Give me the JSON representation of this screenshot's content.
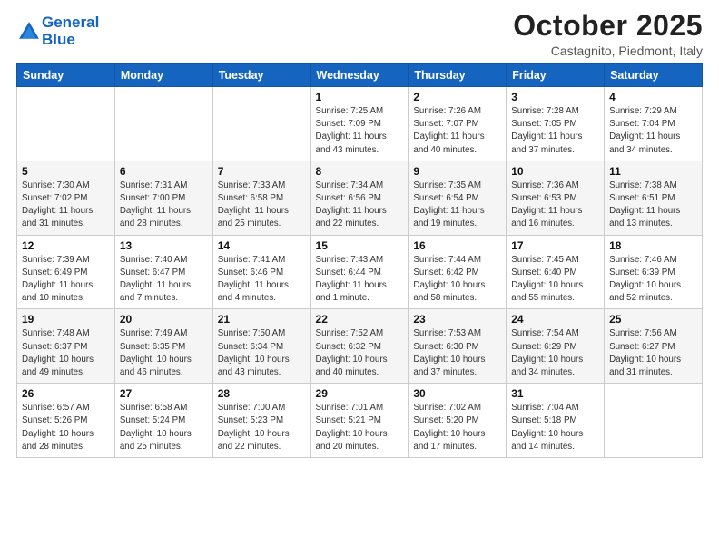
{
  "header": {
    "logo_line1": "General",
    "logo_line2": "Blue",
    "main_title": "October 2025",
    "subtitle": "Castagnito, Piedmont, Italy"
  },
  "days_of_week": [
    "Sunday",
    "Monday",
    "Tuesday",
    "Wednesday",
    "Thursday",
    "Friday",
    "Saturday"
  ],
  "weeks": [
    [
      {
        "day": "",
        "detail": ""
      },
      {
        "day": "",
        "detail": ""
      },
      {
        "day": "",
        "detail": ""
      },
      {
        "day": "1",
        "detail": "Sunrise: 7:25 AM\nSunset: 7:09 PM\nDaylight: 11 hours\nand 43 minutes."
      },
      {
        "day": "2",
        "detail": "Sunrise: 7:26 AM\nSunset: 7:07 PM\nDaylight: 11 hours\nand 40 minutes."
      },
      {
        "day": "3",
        "detail": "Sunrise: 7:28 AM\nSunset: 7:05 PM\nDaylight: 11 hours\nand 37 minutes."
      },
      {
        "day": "4",
        "detail": "Sunrise: 7:29 AM\nSunset: 7:04 PM\nDaylight: 11 hours\nand 34 minutes."
      }
    ],
    [
      {
        "day": "5",
        "detail": "Sunrise: 7:30 AM\nSunset: 7:02 PM\nDaylight: 11 hours\nand 31 minutes."
      },
      {
        "day": "6",
        "detail": "Sunrise: 7:31 AM\nSunset: 7:00 PM\nDaylight: 11 hours\nand 28 minutes."
      },
      {
        "day": "7",
        "detail": "Sunrise: 7:33 AM\nSunset: 6:58 PM\nDaylight: 11 hours\nand 25 minutes."
      },
      {
        "day": "8",
        "detail": "Sunrise: 7:34 AM\nSunset: 6:56 PM\nDaylight: 11 hours\nand 22 minutes."
      },
      {
        "day": "9",
        "detail": "Sunrise: 7:35 AM\nSunset: 6:54 PM\nDaylight: 11 hours\nand 19 minutes."
      },
      {
        "day": "10",
        "detail": "Sunrise: 7:36 AM\nSunset: 6:53 PM\nDaylight: 11 hours\nand 16 minutes."
      },
      {
        "day": "11",
        "detail": "Sunrise: 7:38 AM\nSunset: 6:51 PM\nDaylight: 11 hours\nand 13 minutes."
      }
    ],
    [
      {
        "day": "12",
        "detail": "Sunrise: 7:39 AM\nSunset: 6:49 PM\nDaylight: 11 hours\nand 10 minutes."
      },
      {
        "day": "13",
        "detail": "Sunrise: 7:40 AM\nSunset: 6:47 PM\nDaylight: 11 hours\nand 7 minutes."
      },
      {
        "day": "14",
        "detail": "Sunrise: 7:41 AM\nSunset: 6:46 PM\nDaylight: 11 hours\nand 4 minutes."
      },
      {
        "day": "15",
        "detail": "Sunrise: 7:43 AM\nSunset: 6:44 PM\nDaylight: 11 hours\nand 1 minute."
      },
      {
        "day": "16",
        "detail": "Sunrise: 7:44 AM\nSunset: 6:42 PM\nDaylight: 10 hours\nand 58 minutes."
      },
      {
        "day": "17",
        "detail": "Sunrise: 7:45 AM\nSunset: 6:40 PM\nDaylight: 10 hours\nand 55 minutes."
      },
      {
        "day": "18",
        "detail": "Sunrise: 7:46 AM\nSunset: 6:39 PM\nDaylight: 10 hours\nand 52 minutes."
      }
    ],
    [
      {
        "day": "19",
        "detail": "Sunrise: 7:48 AM\nSunset: 6:37 PM\nDaylight: 10 hours\nand 49 minutes."
      },
      {
        "day": "20",
        "detail": "Sunrise: 7:49 AM\nSunset: 6:35 PM\nDaylight: 10 hours\nand 46 minutes."
      },
      {
        "day": "21",
        "detail": "Sunrise: 7:50 AM\nSunset: 6:34 PM\nDaylight: 10 hours\nand 43 minutes."
      },
      {
        "day": "22",
        "detail": "Sunrise: 7:52 AM\nSunset: 6:32 PM\nDaylight: 10 hours\nand 40 minutes."
      },
      {
        "day": "23",
        "detail": "Sunrise: 7:53 AM\nSunset: 6:30 PM\nDaylight: 10 hours\nand 37 minutes."
      },
      {
        "day": "24",
        "detail": "Sunrise: 7:54 AM\nSunset: 6:29 PM\nDaylight: 10 hours\nand 34 minutes."
      },
      {
        "day": "25",
        "detail": "Sunrise: 7:56 AM\nSunset: 6:27 PM\nDaylight: 10 hours\nand 31 minutes."
      }
    ],
    [
      {
        "day": "26",
        "detail": "Sunrise: 6:57 AM\nSunset: 5:26 PM\nDaylight: 10 hours\nand 28 minutes."
      },
      {
        "day": "27",
        "detail": "Sunrise: 6:58 AM\nSunset: 5:24 PM\nDaylight: 10 hours\nand 25 minutes."
      },
      {
        "day": "28",
        "detail": "Sunrise: 7:00 AM\nSunset: 5:23 PM\nDaylight: 10 hours\nand 22 minutes."
      },
      {
        "day": "29",
        "detail": "Sunrise: 7:01 AM\nSunset: 5:21 PM\nDaylight: 10 hours\nand 20 minutes."
      },
      {
        "day": "30",
        "detail": "Sunrise: 7:02 AM\nSunset: 5:20 PM\nDaylight: 10 hours\nand 17 minutes."
      },
      {
        "day": "31",
        "detail": "Sunrise: 7:04 AM\nSunset: 5:18 PM\nDaylight: 10 hours\nand 14 minutes."
      },
      {
        "day": "",
        "detail": ""
      }
    ]
  ]
}
